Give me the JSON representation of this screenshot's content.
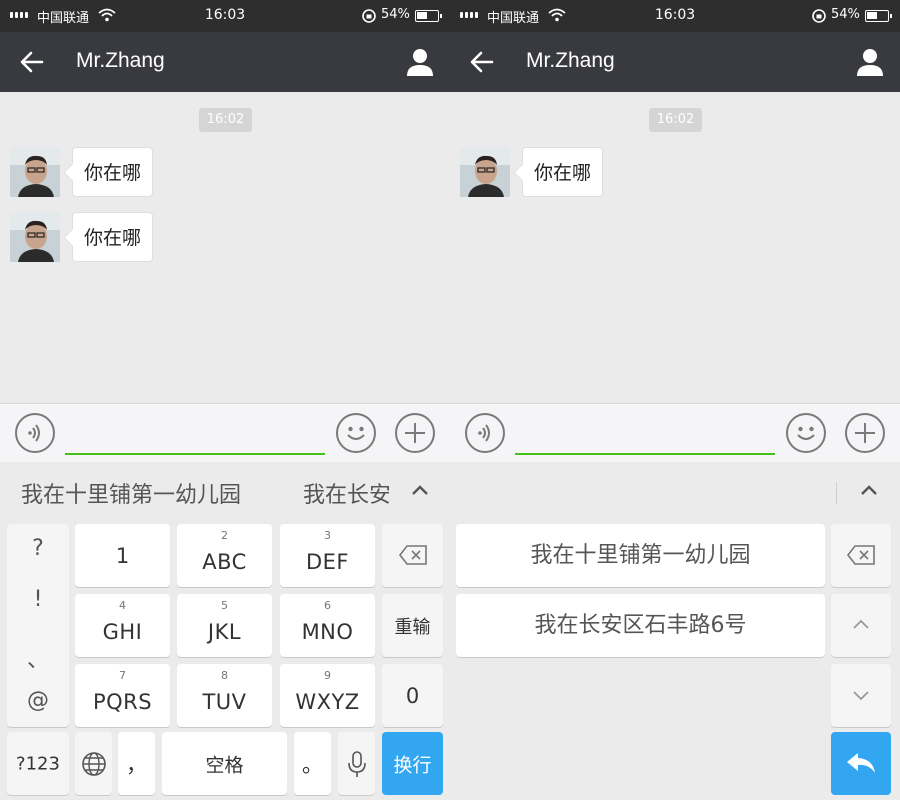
{
  "status_bar": {
    "carrier": "中国联通",
    "time": "16:03",
    "battery": "54%",
    "battery_level": 0.54
  },
  "header": {
    "title": "Mr.Zhang"
  },
  "chat": {
    "timestamp": "16:02",
    "left_messages": [
      {
        "text": "你在哪"
      },
      {
        "text": "你在哪"
      }
    ],
    "right_messages": [
      {
        "text": "你在哪"
      }
    ]
  },
  "input": {
    "value": "",
    "placeholder": ""
  },
  "candidates": [
    "我在十里铺第一幼儿园",
    "我在长安区石丰路6号"
  ],
  "candidate_partial": "我在长安",
  "keyboard": {
    "symbols": [
      "?",
      "!",
      "、",
      "@"
    ],
    "digits": [
      "1",
      "0"
    ],
    "keys": [
      {
        "num": "2",
        "label": "ABC"
      },
      {
        "num": "3",
        "label": "DEF"
      },
      {
        "num": "4",
        "label": "GHI"
      },
      {
        "num": "5",
        "label": "JKL"
      },
      {
        "num": "6",
        "label": "MNO"
      },
      {
        "num": "7",
        "label": "PQRS"
      },
      {
        "num": "8",
        "label": "TUV"
      },
      {
        "num": "9",
        "label": "WXYZ"
      }
    ],
    "reinput": "重输",
    "mode_123": "?123",
    "comma": "，",
    "space": "空格",
    "period": "。",
    "enter": "换行"
  },
  "colors": {
    "header_bg": "#393a3f",
    "accent_green": "#45c01a",
    "accent_blue": "#33a6f2"
  },
  "icons": {
    "back": "back-arrow-icon",
    "profile": "person-icon",
    "voice": "voice-icon",
    "emoji": "emoji-icon",
    "plus": "plus-icon",
    "backspace": "backspace-icon",
    "globe": "globe-icon",
    "mic": "microphone-icon",
    "send": "reply-arrow-icon"
  }
}
